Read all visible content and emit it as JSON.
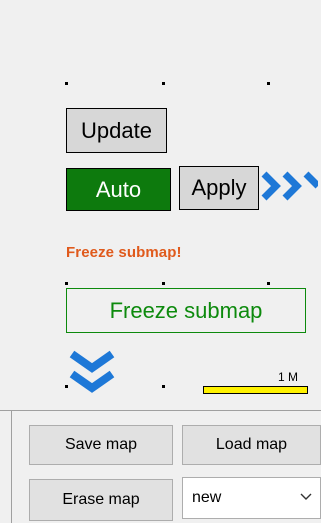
{
  "controls": {
    "update_label": "Update",
    "auto_label": "Auto",
    "apply_label": "Apply"
  },
  "freeze": {
    "warning_text": "Freeze submap!",
    "button_label": "Freeze submap"
  },
  "scale": {
    "label": "1 M"
  },
  "map_actions": {
    "save_label": "Save map",
    "load_label": "Load map",
    "erase_label": "Erase map",
    "selected_map": "new"
  },
  "icons": {
    "expand_right": "double-chevron-right-icon",
    "expand_down": "double-chevron-down-icon",
    "dropdown": "chevron-down-icon"
  },
  "colors": {
    "auto_active": "#0d7a0d",
    "freeze_warning": "#e05a1c",
    "freeze_border": "#0d8a0d",
    "chevron_blue": "#1e78d7",
    "scale_bar": "#fff200"
  }
}
